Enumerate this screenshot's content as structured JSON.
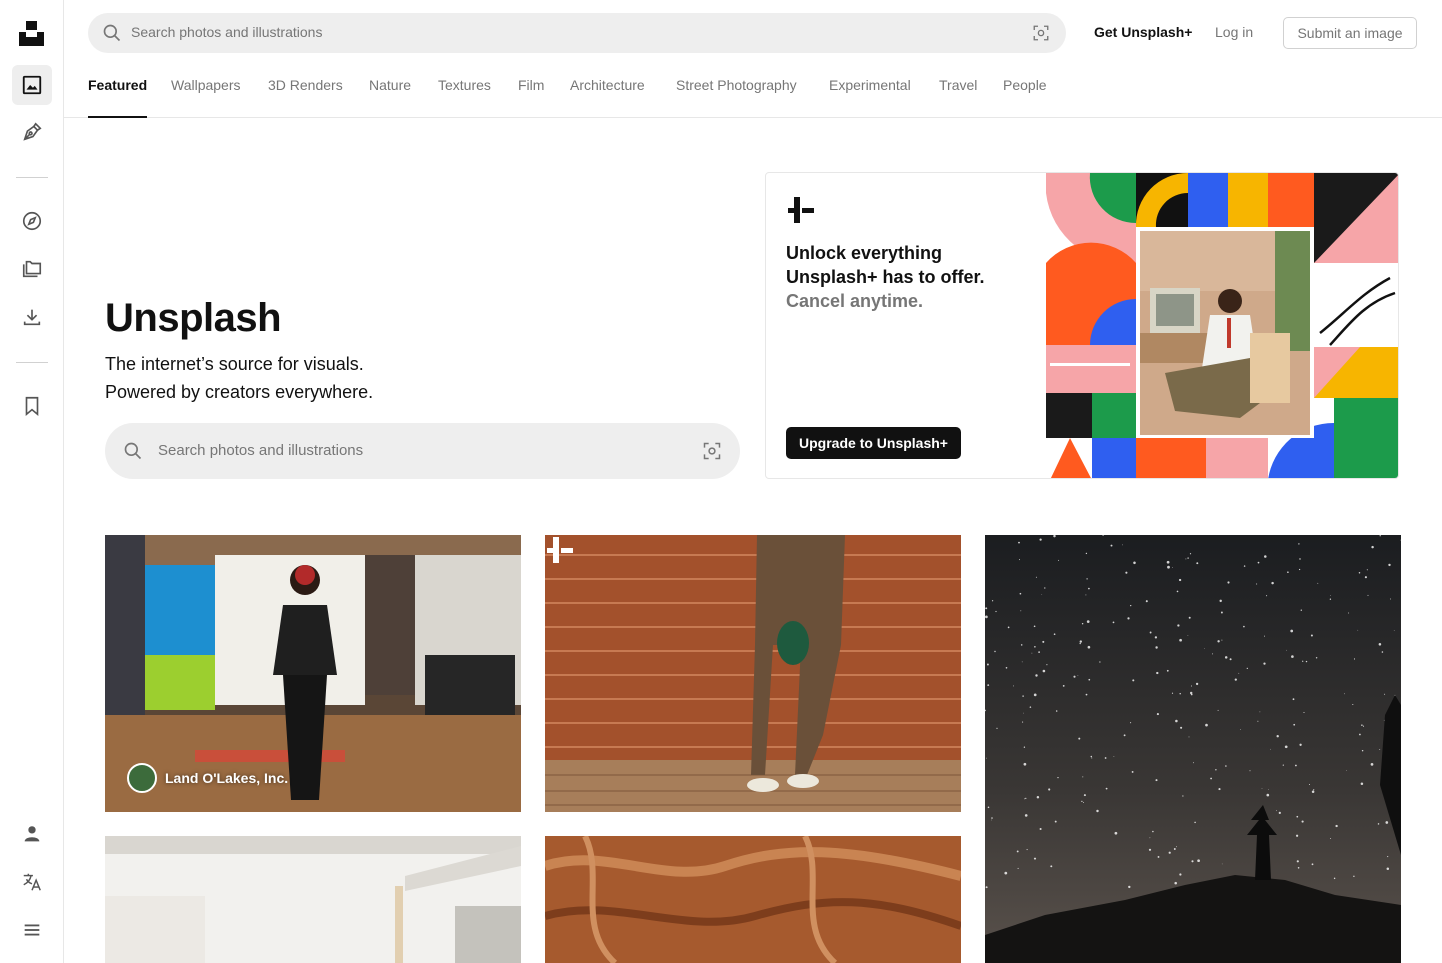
{
  "sidebar": {
    "items": [
      {
        "icon": "photos-icon",
        "active": true
      },
      {
        "icon": "illustrations-icon",
        "active": false
      },
      {
        "icon": "explore-icon",
        "active": false
      },
      {
        "icon": "collections-icon",
        "active": false
      },
      {
        "icon": "download-icon",
        "active": false
      },
      {
        "icon": "bookmark-icon",
        "active": false
      },
      {
        "icon": "user-icon",
        "active": false
      },
      {
        "icon": "translate-icon",
        "active": false
      },
      {
        "icon": "menu-icon",
        "active": false
      }
    ]
  },
  "header": {
    "search_placeholder": "Search photos and illustrations",
    "get_plus": "Get Unsplash+",
    "login": "Log in",
    "submit": "Submit an image"
  },
  "tabs": [
    {
      "label": "Featured",
      "active": true
    },
    {
      "label": "Wallpapers"
    },
    {
      "label": "3D Renders"
    },
    {
      "label": "Nature"
    },
    {
      "label": "Textures"
    },
    {
      "label": "Film"
    },
    {
      "label": "Architecture"
    },
    {
      "label": "Street Photography"
    },
    {
      "label": "Experimental"
    },
    {
      "label": "Travel"
    },
    {
      "label": "People"
    }
  ],
  "hero": {
    "title": "Unsplash",
    "subtitle_1": "The internet’s source for visuals.",
    "subtitle_2": "Powered by creators everywhere.",
    "search_placeholder": "Search photos and illustrations"
  },
  "promo": {
    "line_1": "Unlock everything",
    "line_2": "Unsplash+ has to offer.",
    "line_3": "Cancel anytime.",
    "button": "Upgrade to Unsplash+"
  },
  "photos": [
    {
      "alt": "woman in salon",
      "credit": "Land O'Lakes, Inc."
    },
    {
      "alt": "person against brick wall",
      "plus": true
    },
    {
      "alt": "starry night sky"
    },
    {
      "alt": "white interior room"
    },
    {
      "alt": "sand texture"
    }
  ],
  "colors": {
    "text": "#111111",
    "muted": "#767676",
    "surface": "#eeeeee",
    "border": "#d1d1d1"
  }
}
